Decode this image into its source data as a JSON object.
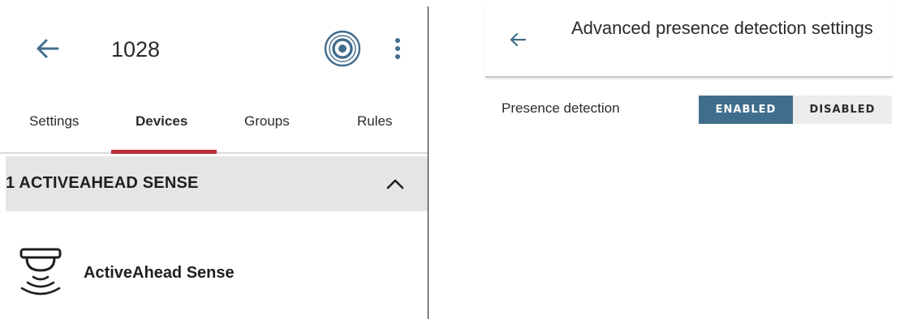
{
  "left_screen": {
    "header": {
      "title": "1028",
      "back_icon": "arrow-left-icon",
      "presence_icon": "presence-target-icon",
      "more_icon": "more-vertical-icon"
    },
    "tabs": [
      {
        "label": "Settings",
        "active": false
      },
      {
        "label": "Devices",
        "active": true
      },
      {
        "label": "Groups",
        "active": false
      },
      {
        "label": "Rules",
        "active": false
      }
    ],
    "group": {
      "title": "1 ACTIVEAHEAD SENSE",
      "expanded": true
    },
    "devices": [
      {
        "name": "ActiveAhead Sense",
        "icon": "sensor-icon"
      }
    ]
  },
  "right_screen": {
    "header": {
      "title": "Advanced presence detection settings",
      "back_icon": "arrow-left-icon"
    },
    "setting": {
      "label": "Presence detection",
      "options": [
        "ENABLED",
        "DISABLED"
      ],
      "selected": "ENABLED"
    }
  },
  "colors": {
    "accent_blue": "#416d8c",
    "tab_indicator_red": "#b72e35",
    "group_header_bg": "#e5e5e5",
    "segment_inactive_bg": "#ececec"
  }
}
